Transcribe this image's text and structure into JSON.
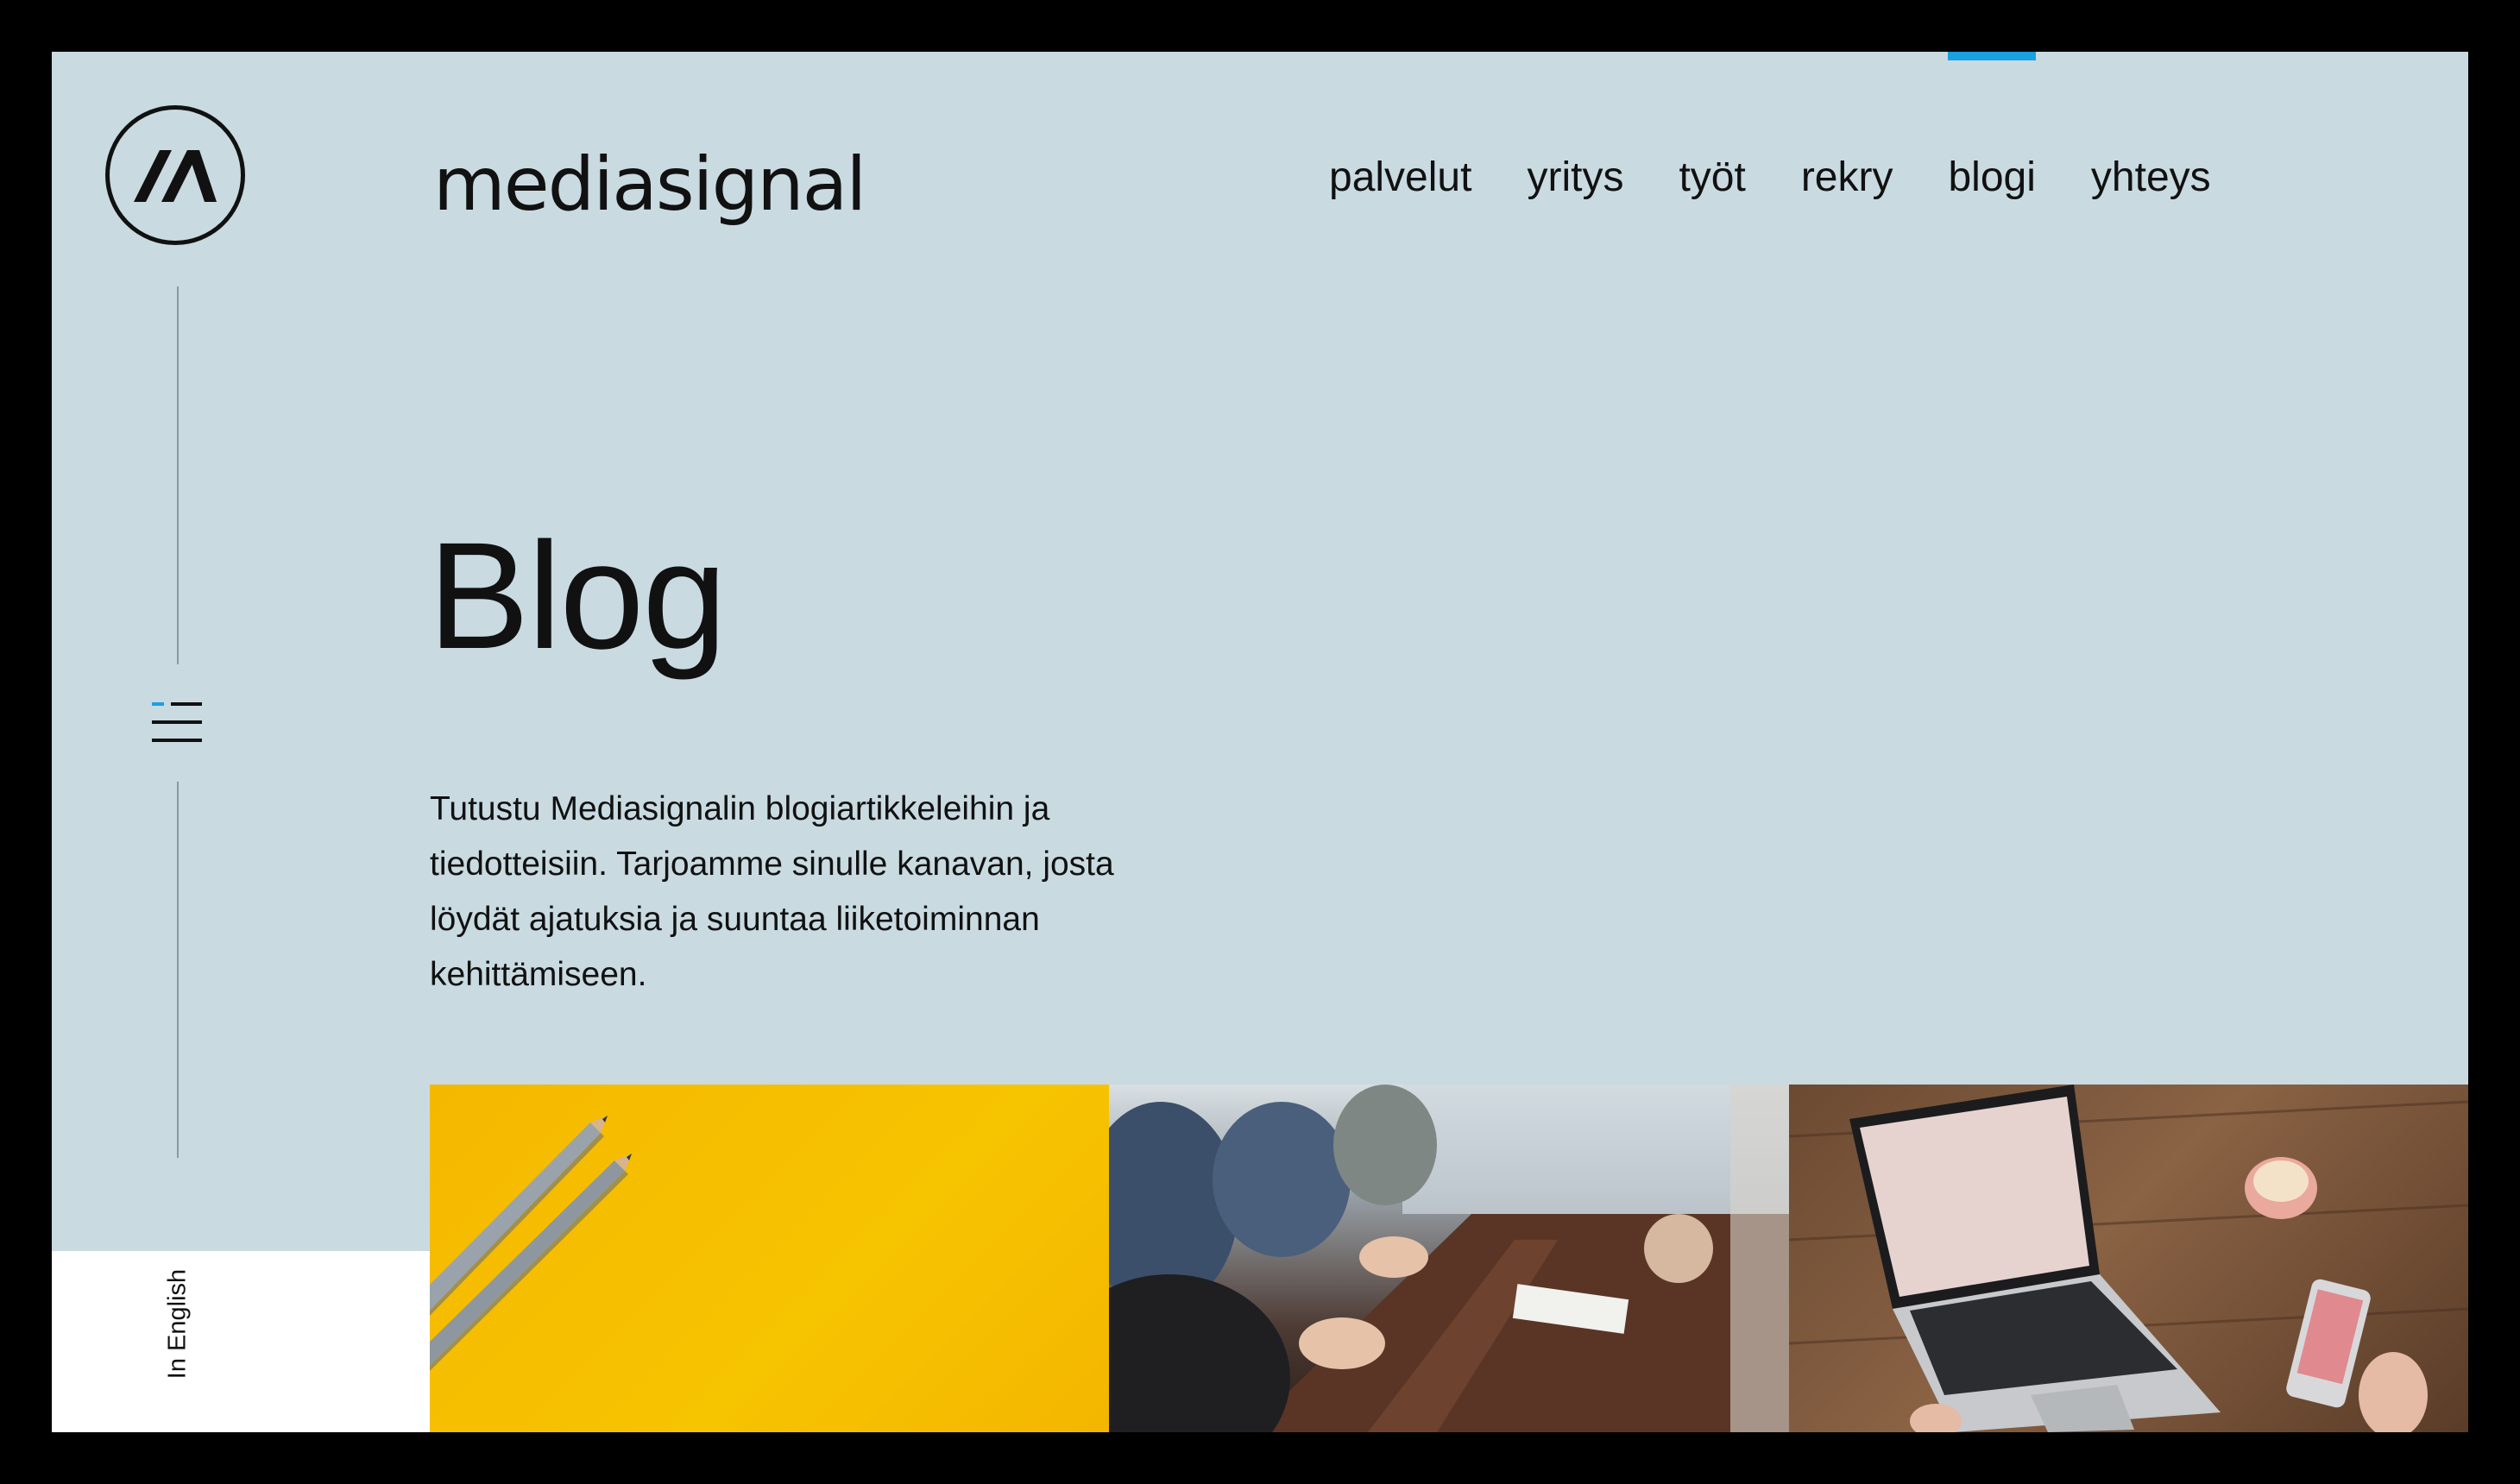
{
  "brand": {
    "name": "mediasignal",
    "icon": "monogram-m-icon"
  },
  "nav": {
    "items": [
      {
        "label": "palvelut",
        "active": false
      },
      {
        "label": "yritys",
        "active": false
      },
      {
        "label": "työt",
        "active": false
      },
      {
        "label": "rekry",
        "active": false
      },
      {
        "label": "blogi",
        "active": true
      },
      {
        "label": "yhteys",
        "active": false
      }
    ],
    "active_color": "#1aa0e0"
  },
  "sidebar": {
    "menu_icon": "hamburger-menu-icon",
    "language_link": "In English"
  },
  "hero": {
    "title": "Blog",
    "intro": "Tutustu Mediasignalin blogiartikkeleihin ja tiedotteisiin. Tarjoamme sinulle kana­van, josta löydät ajatuksia ja suuntaa lii­ketoiminnan kehittämiseen."
  },
  "cards": [
    {
      "image": "pencils-on-yellow-image"
    },
    {
      "image": "meeting-table-image"
    },
    {
      "image": "laptop-on-desk-image"
    }
  ],
  "colors": {
    "background": "#c9dae1",
    "text": "#111111",
    "accent": "#1aa0e0"
  }
}
